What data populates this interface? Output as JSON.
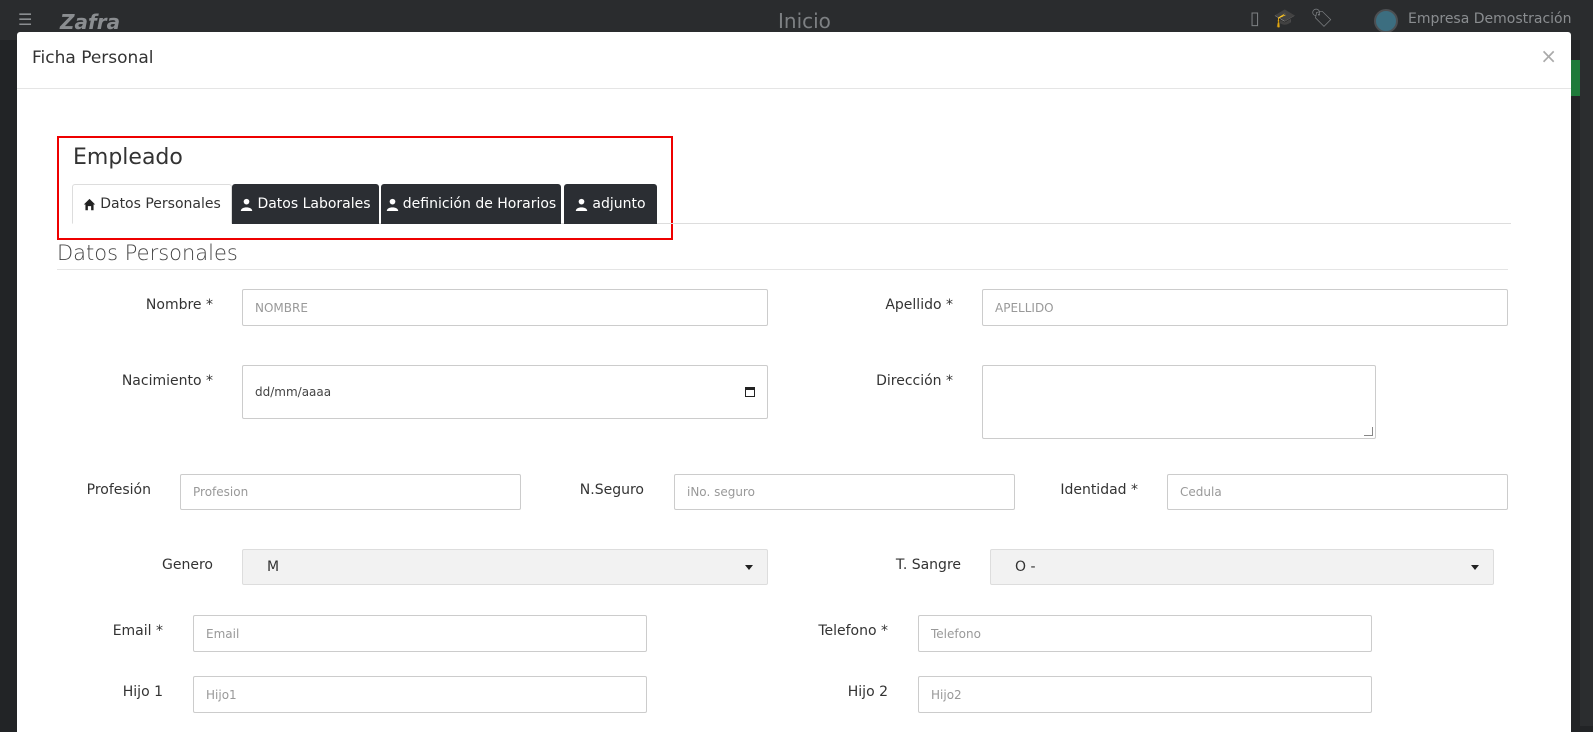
{
  "background": {
    "app_logo": "Zafra",
    "page_title": "Inicio",
    "company": "Empresa Demostración"
  },
  "modal": {
    "title": "Ficha Personal",
    "close_label": "×"
  },
  "employee": {
    "heading": "Empleado",
    "tabs": [
      {
        "label": "Datos Personales",
        "icon": "home-icon",
        "active": true
      },
      {
        "label": "Datos Laborales",
        "icon": "user-icon",
        "active": false
      },
      {
        "label": "definición de Horarios",
        "icon": "user-icon",
        "active": false
      },
      {
        "label": "adjunto",
        "icon": "user-icon",
        "active": false
      }
    ]
  },
  "section": {
    "title": "Datos Personales"
  },
  "form": {
    "nombre": {
      "label": "Nombre *",
      "placeholder": "NOMBRE"
    },
    "apellido": {
      "label": "Apellido *",
      "placeholder": "APELLIDO"
    },
    "nacimiento": {
      "label": "Nacimiento *",
      "value": "dd/mm/aaaa"
    },
    "direccion": {
      "label": "Dirección *"
    },
    "profesion": {
      "label": "Profesión",
      "placeholder": "Profesion"
    },
    "nseguro": {
      "label": "N.Seguro",
      "placeholder": "iNo. seguro"
    },
    "identidad": {
      "label": "Identidad *",
      "placeholder": "Cedula"
    },
    "genero": {
      "label": "Genero",
      "value": "M"
    },
    "sangre": {
      "label": "T. Sangre",
      "value": "O -"
    },
    "email": {
      "label": "Email *",
      "placeholder": "Email"
    },
    "telefono": {
      "label": "Telefono *",
      "placeholder": "Telefono"
    },
    "hijo1": {
      "label": "Hijo 1",
      "placeholder": "Hijo1"
    },
    "hijo2": {
      "label": "Hijo 2",
      "placeholder": "Hijo2"
    }
  }
}
